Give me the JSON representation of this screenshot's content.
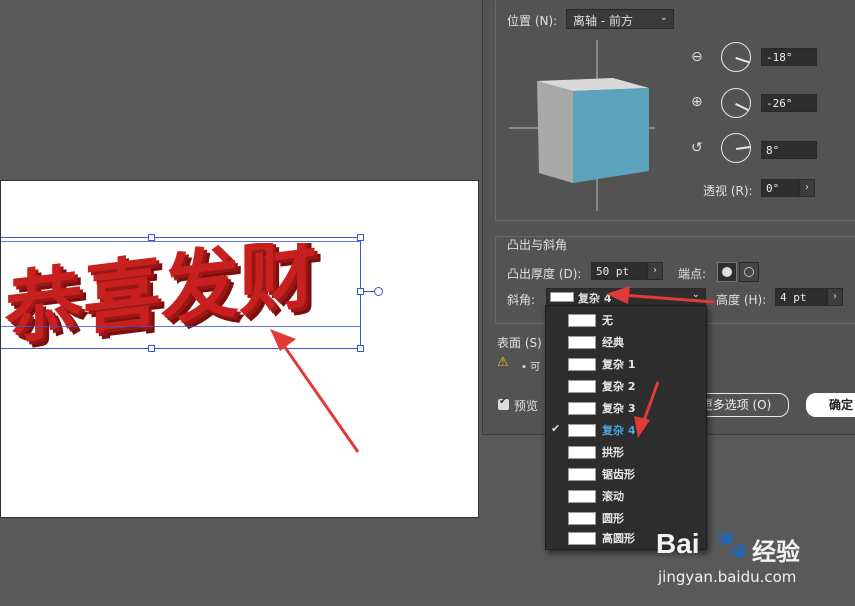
{
  "artwork": {
    "text": "恭喜发财"
  },
  "dialog": {
    "position_label": "位置 (N):",
    "position_value": "离轴 - 前方",
    "rot_x": "-18°",
    "rot_y": "-26°",
    "rot_z": "8°",
    "perspective_label": "透视 (R):",
    "perspective_value": "0°",
    "extrude_section": "凸出与斜角",
    "extrude_depth_label": "凸出厚度 (D):",
    "extrude_depth_value": "50 pt",
    "cap_label": "端点:",
    "bevel_label": "斜角:",
    "bevel_value": "复杂 4",
    "height_label": "高度 (H):",
    "height_value": "4 pt",
    "surface_label": "表面 (S)",
    "warning_text": "• 可",
    "preview_label": "预览",
    "more_options_label": "更多选项 (O)",
    "ok_label": "确定"
  },
  "bevel_menu": {
    "items": [
      "无",
      "经典",
      "复杂 1",
      "复杂 2",
      "复杂 3",
      "复杂 4",
      "拱形",
      "锯齿形",
      "滚动",
      "圆形",
      "高圆形"
    ],
    "selected_index": 5
  },
  "colors": {
    "cube_front": "#5ba3bd",
    "cube_side": "#a9a9a9",
    "cube_top": "#d9d9d9",
    "text_red": "#c8201e",
    "arrow_red": "#e03b36",
    "selection_blue": "#3a56d8"
  },
  "watermark": {
    "brand": "Bai",
    "brand_suffix": "经验",
    "url": "jingyan.baidu.com"
  }
}
